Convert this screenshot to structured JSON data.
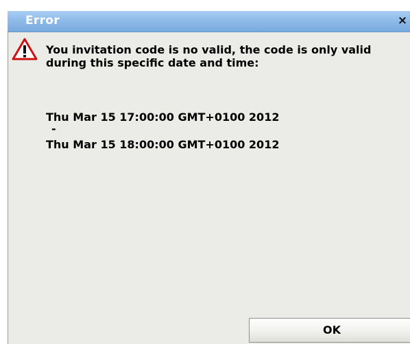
{
  "dialog": {
    "title": "Error",
    "close_glyph": "×",
    "icon": "warning-triangle-icon",
    "message": "You invitation code is no valid, the code is only valid during this specific date and time:",
    "start_time": "Thu Mar 15 17:00:00 GMT+0100 2012",
    "separator": "-",
    "end_time": "Thu Mar 15 18:00:00 GMT+0100 2012",
    "ok_label": "OK"
  },
  "colors": {
    "titlebar": "#8ebbe9",
    "body_background": "#ebece8",
    "warning_red": "#d01010"
  }
}
